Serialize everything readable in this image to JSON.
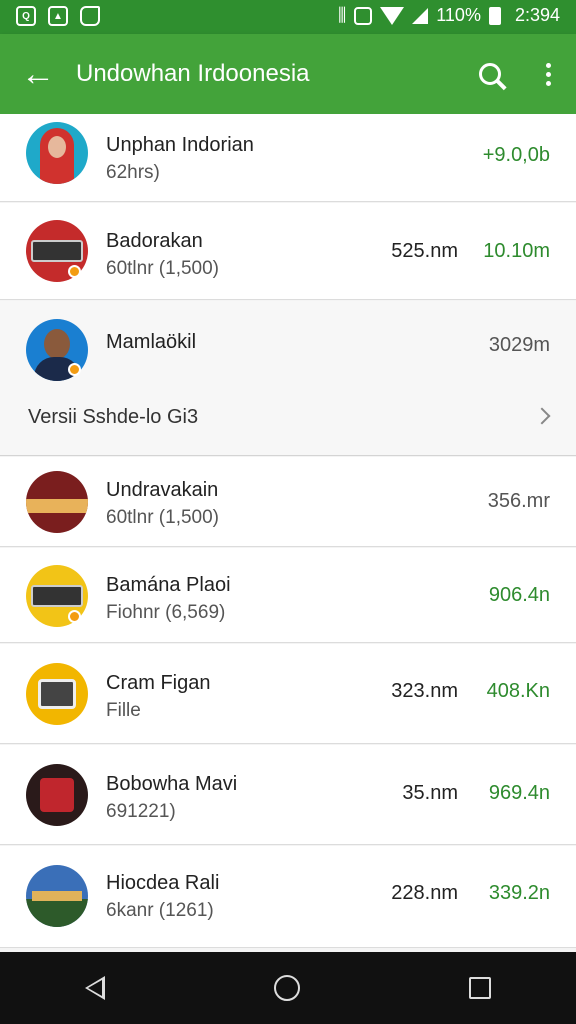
{
  "status_bar": {
    "battery_text": "110%",
    "time": "2:394",
    "icons": [
      "app-icon",
      "image-icon",
      "tag-icon",
      "vibrate-icon",
      "wifi-icon",
      "signal-icon",
      "battery-icon"
    ]
  },
  "app_bar": {
    "title": "Undowhan Irdoonesia",
    "back_icon": "arrow-left-icon",
    "search_icon": "search-icon",
    "more_icon": "more-vert-icon"
  },
  "colors": {
    "status_bar": "#2f8f2f",
    "app_bar": "#43a33a",
    "amount_green": "#2e8b2e"
  },
  "items": [
    {
      "name": "Unphan Indorian",
      "sub": "62hrs)",
      "mid": "",
      "amount": "+9.0,0b",
      "amount_color": "green"
    },
    {
      "name": "Badorakan",
      "sub": "60tlnr (1,500)",
      "mid": "525.nm",
      "amount": "10.10m",
      "amount_color": "green"
    },
    {
      "name": "Mamlaökil",
      "sub": "",
      "mid": "",
      "amount": "3029m",
      "amount_color": "gray"
    },
    {
      "name": "Undravakain",
      "sub": "60tlnr (1,500)",
      "mid": "",
      "amount": "356.mr",
      "amount_color": "gray"
    },
    {
      "name": "Bamána Plaoi",
      "sub": "Fiohnr (6,569)",
      "mid": "",
      "amount": "906.4n",
      "amount_color": "green"
    },
    {
      "name": "Cram Figan",
      "sub": "Fille",
      "mid": "323.nm",
      "amount": "408.Kn",
      "amount_color": "green"
    },
    {
      "name": "Bobowha Mavi",
      "sub": "691221)",
      "mid": "35.nm",
      "amount": "969.4n",
      "amount_color": "green"
    },
    {
      "name": "Hiocdea Rali",
      "sub": "6kanr (1261)",
      "mid": "228.nm",
      "amount": "339.2n",
      "amount_color": "green"
    }
  ],
  "subsection": {
    "label": "Versii Sshde-lo Gi3",
    "icon": "chevron-right-icon"
  },
  "nav_bar": {
    "icons": [
      "back-triangle-icon",
      "home-circle-icon",
      "recents-square-icon"
    ]
  }
}
